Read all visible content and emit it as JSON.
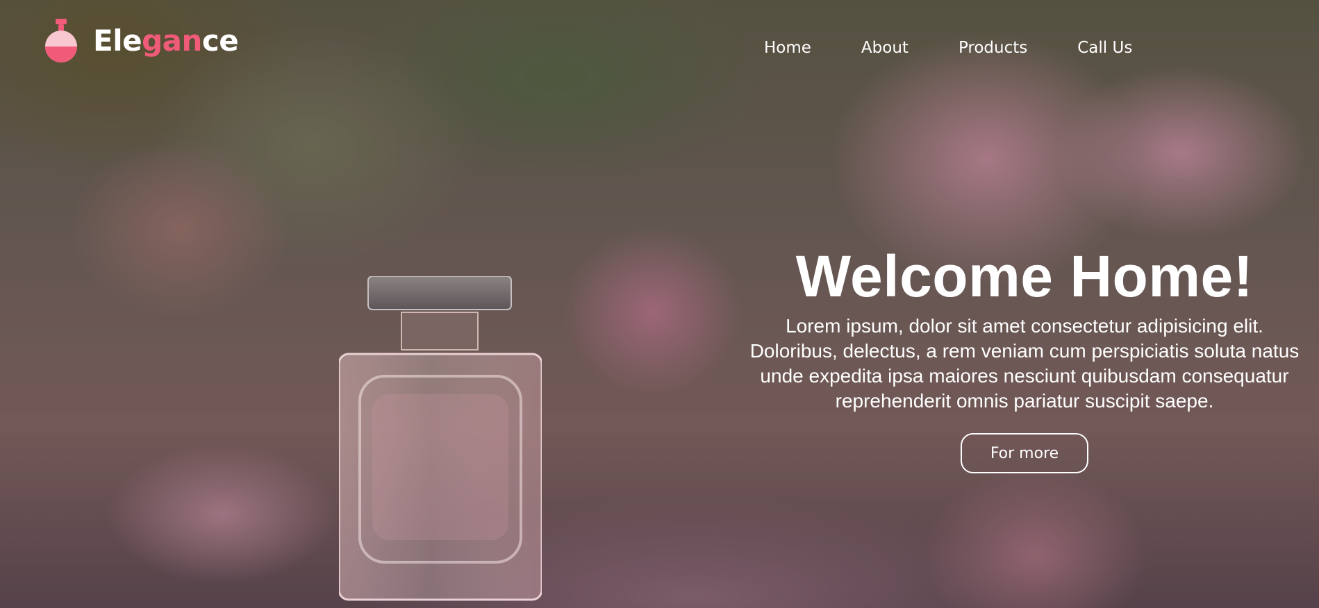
{
  "brand": {
    "part1": "Ele",
    "part2": "gan",
    "part3": "ce",
    "accent_color": "#ef5b79",
    "icon": "perfume-bottle-icon"
  },
  "nav": {
    "items": [
      {
        "label": "Home"
      },
      {
        "label": "About"
      },
      {
        "label": "Products"
      },
      {
        "label": "Call Us"
      }
    ]
  },
  "hero": {
    "title": "Welcome Home!",
    "description": "Lorem ipsum, dolor sit amet consectetur adipisicing elit. Doloribus, delectus, a rem veniam cum perspiciatis soluta natus unde expedita ipsa maiores nesciunt quibusdam consequatur reprehenderit omnis pariatur suscipit saepe.",
    "cta_label": "For more"
  }
}
